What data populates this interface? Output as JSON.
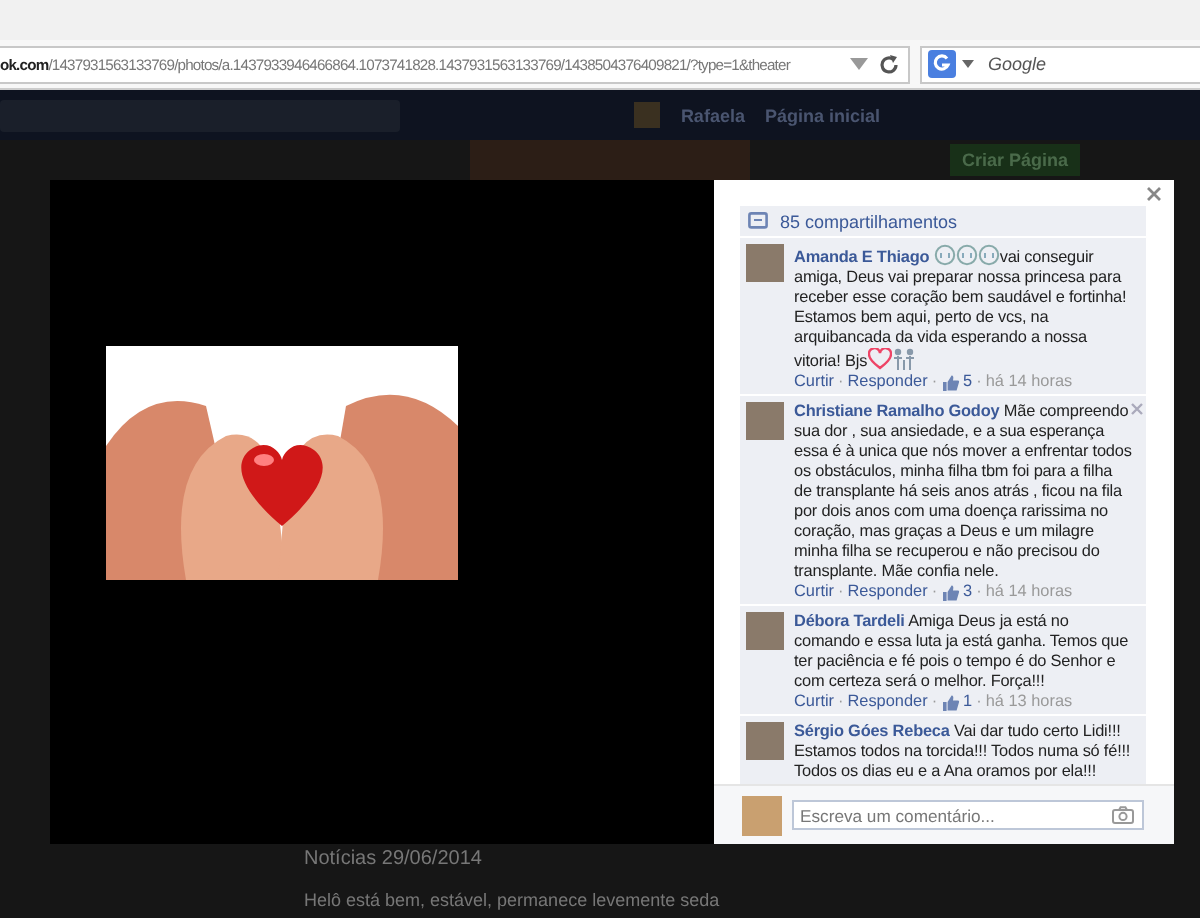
{
  "browser": {
    "url": "**ok.com**/1437931563133769/photos/a.1437933946466864.1073741828.1437931563133769/1438504376409821/?type=1&theater",
    "search_placeholder": "Google"
  },
  "navbar": {
    "user": "Rafaela",
    "home": "Página inicial"
  },
  "page": {
    "create_page": "Criar Página",
    "post_title": "Notícias 29/06/2014",
    "post_text": "Helô está bem, estável, permanece levemente seda"
  },
  "viewer": {
    "shares": "85 compartilhamentos",
    "comments": [
      {
        "author": "Amanda E Thiago",
        "show_remove": false,
        "segments": [
          {
            "kind": "cry"
          },
          {
            "kind": "cry"
          },
          {
            "kind": "cry"
          },
          {
            "kind": "text",
            "text": "vai conseguir amiga, Deus vai preparar nossa princesa para receber esse coração bem saudável e fortinha! Estamos bem aqui, perto de vcs, na arquibancada da vida esperando a nossa vitoria! Bjs"
          },
          {
            "kind": "heart"
          },
          {
            "kind": "family"
          }
        ],
        "like": "Curtir",
        "reply": "Responder",
        "likes": "5",
        "time": "há 14 horas",
        "separators": [
          "·",
          "·",
          "·"
        ]
      },
      {
        "author": "Christiane Ramalho Godoy",
        "show_remove": true,
        "segments": [
          {
            "kind": "text",
            "text": "Mãe compreendo sua dor , sua ansiedade, e a sua esperança essa é à unica que nós mover a enfrentar todos os obstáculos, minha filha tbm foi para a filha de transplante há seis anos atrás , ficou na fila por dois anos com uma doença rarissima no coração, mas graças a Deus e um milagre minha filha se recuperou e não precisou do transplante. Mãe confia nele."
          }
        ],
        "like": "Curtir",
        "reply": "Responder",
        "likes": "3",
        "time": "há 14 horas",
        "separators": [
          "·",
          "·",
          "·"
        ]
      },
      {
        "author": "Débora Tardeli",
        "show_remove": false,
        "segments": [
          {
            "kind": "text",
            "text": "Amiga Deus ja está no comando e essa luta ja está ganha. Temos que ter paciência e fé pois o tempo é do Senhor e com certeza será o melhor. Força!!!"
          }
        ],
        "like": "Curtir",
        "reply": "Responder",
        "likes": "1",
        "time": "há 13 horas",
        "separators": [
          "·",
          "·",
          "·"
        ]
      },
      {
        "author": "Sérgio Góes Rebeca",
        "show_remove": false,
        "segments": [
          {
            "kind": "text",
            "text": "Vai dar tudo certo Lidi!!! Estamos todos na torcida!!! Todos numa só fé!!! Todos os dias eu e a Ana oramos por ela!!!"
          }
        ]
      }
    ],
    "comment_placeholder": "Escreva um comentário..."
  }
}
